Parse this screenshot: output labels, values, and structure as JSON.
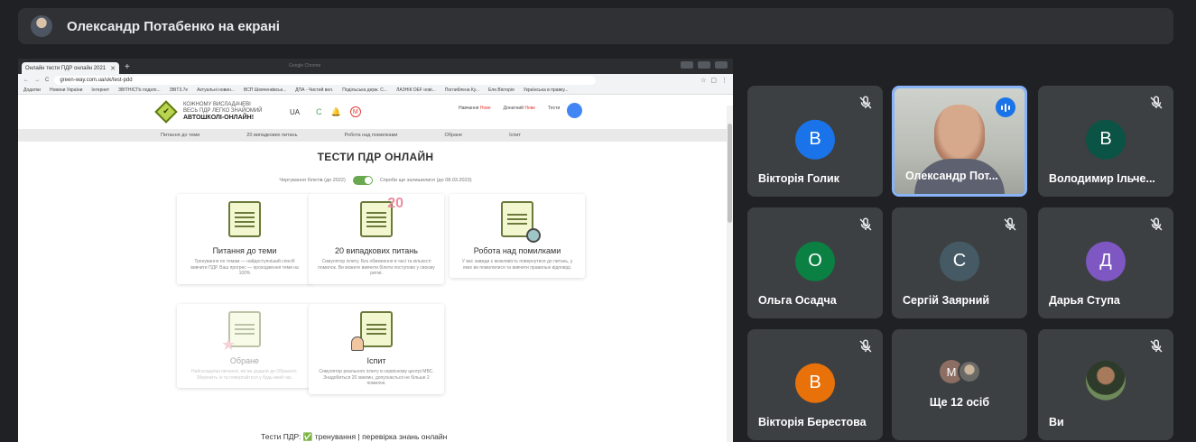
{
  "presenter": {
    "label": "Олександр Потабенко на екрані"
  },
  "screen": {
    "tab_title": "Онлайн тести ПДР онлайн 2021",
    "window_title": "Google Chrome",
    "url": "green-way.com.ua/uk/test-pdd",
    "bookmarks": [
      "Додатки",
      "Новини України",
      "Інтернет",
      "ЗВІТНІСТЬ податк...",
      "ЗВІТ3.7е",
      "Актуальні новин...",
      "ВСП Шевченківськ...",
      "ДПА - Чистий вел.",
      "Подільська держ. С...",
      "ЛАЗНІК DEF нові...",
      "Поглиблена Ку...",
      "Еле.Вікторія",
      "Українська в правку..."
    ],
    "logo_lines": [
      "КОЖНОМУ ВИСЛАДАЧЕВІ",
      "ВЕСЬ ПДР ЛЕГКО ЗНАЙОМИЙ",
      "АВТОШКОЛІ-ОНЛАЙН!"
    ],
    "lang": "UA",
    "header_c": "C",
    "header_m": "M",
    "header_links": [
      "Навчання",
      "Донатний",
      "Тести"
    ],
    "header_badge": "Нове",
    "nav": [
      "Питання до теми",
      "20 випадкових питань",
      "Робота над помилками",
      "Обране",
      "Іспит"
    ],
    "page_title": "ТЕСТИ ПДР ОНЛАЙН",
    "toggle_left": "Чергування білетів (до 2022)",
    "toggle_right": "Спроби ще залишилися (до 08.03.2023)",
    "cards": [
      {
        "title": "Питання до теми",
        "desc": "Тренування по темам — найдоступніший спосіб вивчити ПДР. Ваш прогрес — проходження теми на 100%"
      },
      {
        "title": "20 випадкових питань",
        "desc": "Симулятор іспиту. Без обмеження в часі та кількості помилок. Ви можете вивчити білети поступово у своєму ритмі."
      },
      {
        "title": "Робота над помилками",
        "desc": "У вас завжди є можливість повернутися до питань, у яких ви помилилися та вивчити правильні відповіді."
      },
      {
        "title": "Обране",
        "desc": "Найскладніші питання, які ви додали до Обраного. Збережіть їх та повертайтеся у будь-який час."
      },
      {
        "title": "Іспит",
        "desc": "Симулятор реального іспиту в сервісному центрі МВС. Знадобиться 20 хвилин, допускається не більше 2 помилок."
      }
    ],
    "footer": "Тести ПДР: ✅ тренування | перевірка знань онлайн"
  },
  "participants": [
    {
      "name": "Вікторія Голик",
      "initial": "В",
      "color": "#1a73e8",
      "muted": true
    },
    {
      "name": "Олександр Пот...",
      "video": true,
      "speaking": true
    },
    {
      "name": "Володимир Ільче...",
      "initial": "В",
      "color": "#0b5345",
      "muted": true
    },
    {
      "name": "Ольга Осадча",
      "initial": "О",
      "color": "#0b8043",
      "muted": true
    },
    {
      "name": "Сергій Заярний",
      "initial": "С",
      "color": "#455a64",
      "muted": true
    },
    {
      "name": "Дарья Ступа",
      "initial": "Д",
      "color": "#7e57c2",
      "muted": true
    },
    {
      "name": "Вікторія Берестова",
      "initial": "В",
      "color": "#e8710a",
      "muted": true
    },
    {
      "more_label": "Ще 12 осіб",
      "more_initial": "М"
    },
    {
      "name": "Ви",
      "self": true
    }
  ],
  "colors": {
    "background": "#202124",
    "tile": "#3c4043",
    "accent": "#8ab4f8"
  }
}
